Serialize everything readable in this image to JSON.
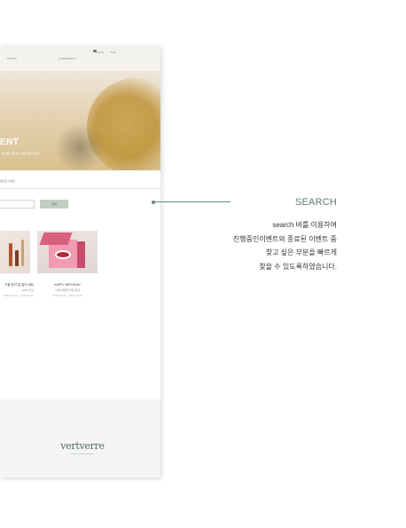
{
  "nav": {
    "story": "STORY",
    "community": "COMMUNITY",
    "login": "LOGIN",
    "join": "JOIN"
  },
  "hero": {
    "title": "ENT",
    "subtitle": "에 대한 다양한 소식을 확인 하세요."
  },
  "breadcrumb": "종료된 이벤트",
  "search": {
    "placeholder": "",
    "button": "검색"
  },
  "events": [
    {
      "title": "가을 맞이 립 컬러 세트",
      "sub": "~ 20% 할인",
      "date": "2019.10.01 ~ 2019.10.31"
    },
    {
      "title": "HAPPY BIRTHDAY",
      "sub": "이 달 생일자 쿠폰 증정",
      "date": "2019.10.01 ~ 2019.10.31"
    }
  ],
  "footer": {
    "logo": "vertverre"
  },
  "annotation": {
    "title": "SEARCH",
    "lines": [
      "search 바를 이용하여",
      "진행중인이벤트와 종료된  이벤트 중",
      "찾고 싶은  부분을  빠르게",
      "찾을 수 있도록하였습니다."
    ]
  },
  "colors": {
    "accent": "#5e7d6c",
    "search_button": "#c3cdc3",
    "footer_bg": "#f5f5f5"
  }
}
